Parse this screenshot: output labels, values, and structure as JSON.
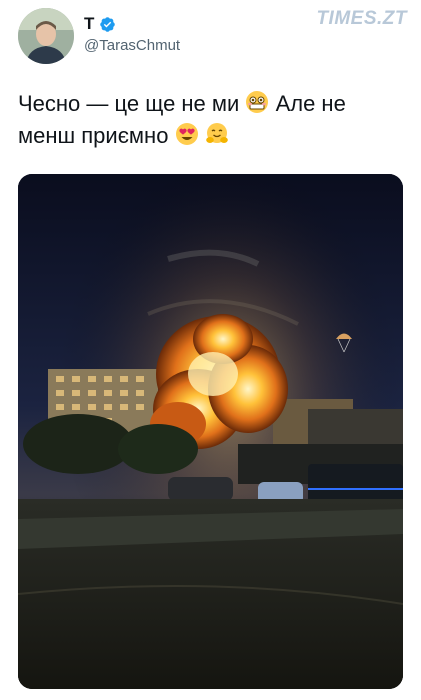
{
  "tweet": {
    "author_name": "T",
    "handle": "@TarasChmut",
    "text_part1": "Чесно — це ще не ми",
    "text_part2": "Але не менш приємно"
  },
  "watermark": "TIMES.ZT",
  "icons": {
    "verified": "verified-badge-icon",
    "emoji1": "flushed-face-emoji",
    "emoji2": "heart-eyes-emoji",
    "emoji3": "hugging-face-emoji"
  },
  "colors": {
    "verified": "#1d9bf0",
    "watermark": "#b8c8d8",
    "text": "#0f1419",
    "handle": "#536471"
  }
}
